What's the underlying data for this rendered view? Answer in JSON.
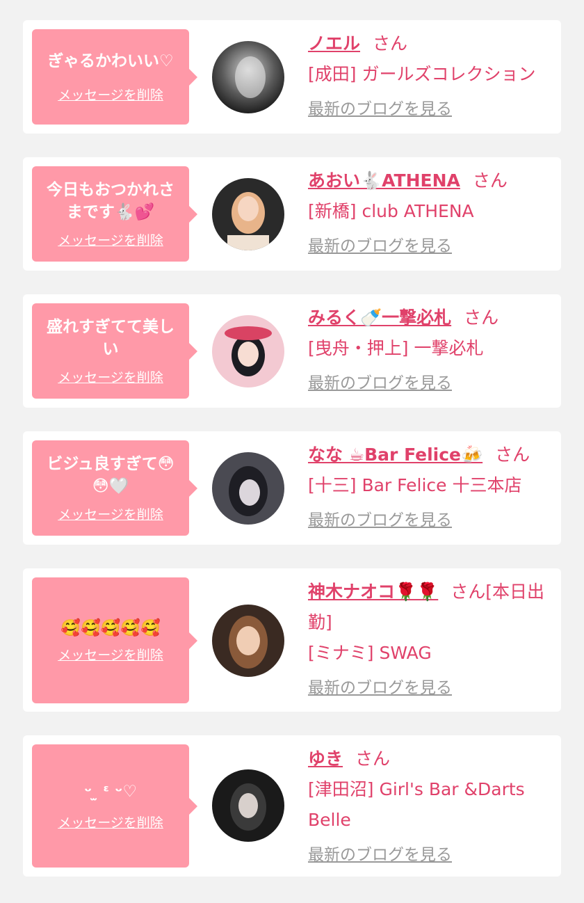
{
  "colors": {
    "background": "#f2f2f2",
    "card": "#ffffff",
    "bubble": "#ff99a8",
    "name_pink": "#e0416a",
    "blog_gray": "#999999"
  },
  "labels": {
    "delete_message": "メッセージを削除",
    "latest_blog": "最新のブログを見る",
    "honorific": "さん"
  },
  "entries": [
    {
      "message": "ぎゃるかわいい♡",
      "name": "ノエル",
      "status": "",
      "shop": "[成田] ガールズコレクション",
      "avatar_icon": "avatar-photo"
    },
    {
      "message": "今日もおつかれさまです🐇💕",
      "name": "あおい🐇ATHENA",
      "status": "",
      "shop": "[新橋] club ATHENA",
      "avatar_icon": "avatar-photo"
    },
    {
      "message": "盛れすぎてて美しい",
      "name": "みるく🍼一撃必札",
      "status": "",
      "shop": "[曳舟・押上] 一撃必札",
      "avatar_icon": "avatar-photo"
    },
    {
      "message": "ビジュ良すぎて😳😳🤍",
      "name": "なな ☕Bar Felice🍻",
      "status": "",
      "shop": "[十三] Bar Felice 十三本店",
      "avatar_icon": "avatar-photo"
    },
    {
      "message": "🥰🥰🥰🥰🥰",
      "name": "神木ナオコ🌹🌹",
      "status": "[本日出勤]",
      "shop": "[ミナミ] SWAG",
      "avatar_icon": "avatar-photo"
    },
    {
      "message": "ᵕ ̫ ᵋ ᵕ♡",
      "name": "ゆき",
      "status": "",
      "shop": "[津田沼] Girl's Bar &Darts Belle",
      "avatar_icon": "avatar-photo"
    }
  ]
}
